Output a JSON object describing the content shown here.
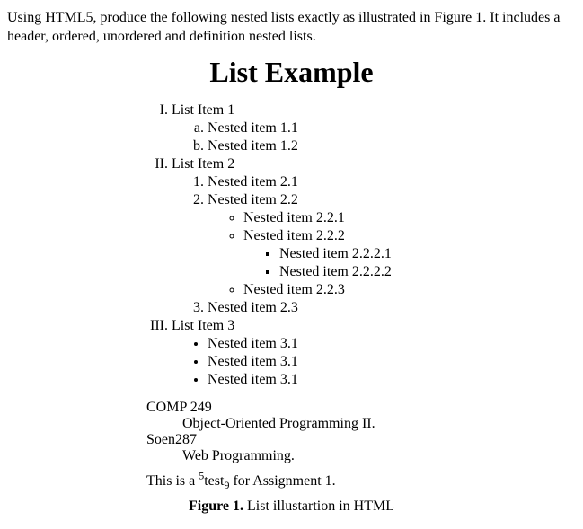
{
  "intro": "Using HTML5, produce the following nested lists exactly as illustrated in Figure 1. It includes a header, ordered, unordered and definition nested lists.",
  "heading": "List Example",
  "list": {
    "i1": "List Item 1",
    "i1a": "Nested item 1.1",
    "i1b": "Nested item 1.2",
    "i2": "List Item 2",
    "i2_1": "Nested item 2.1",
    "i2_2": "Nested item 2.2",
    "i2_2_1": "Nested item 2.2.1",
    "i2_2_2": "Nested item 2.2.2",
    "i2_2_2_1": "Nested item 2.2.2.1",
    "i2_2_2_2": "Nested item 2.2.2.2",
    "i2_2_3": "Nested item 2.2.3",
    "i2_3": "Nested item 2.3",
    "i3": "List Item 3",
    "i3_1": "Nested item 3.1",
    "i3_2": "Nested item 3.1",
    "i3_3": "Nested item 3.1"
  },
  "defs": {
    "t1": "COMP 249",
    "d1": "Object-Oriented Programming II.",
    "t2": "Soen287",
    "d2": "Web Programming."
  },
  "footer": {
    "pre": "This is a ",
    "sup": "5",
    "mid": "test",
    "sub": "9",
    "post": " for Assignment 1."
  },
  "caption": {
    "bold": "Figure 1.",
    "rest": " List illustartion in HTML"
  }
}
